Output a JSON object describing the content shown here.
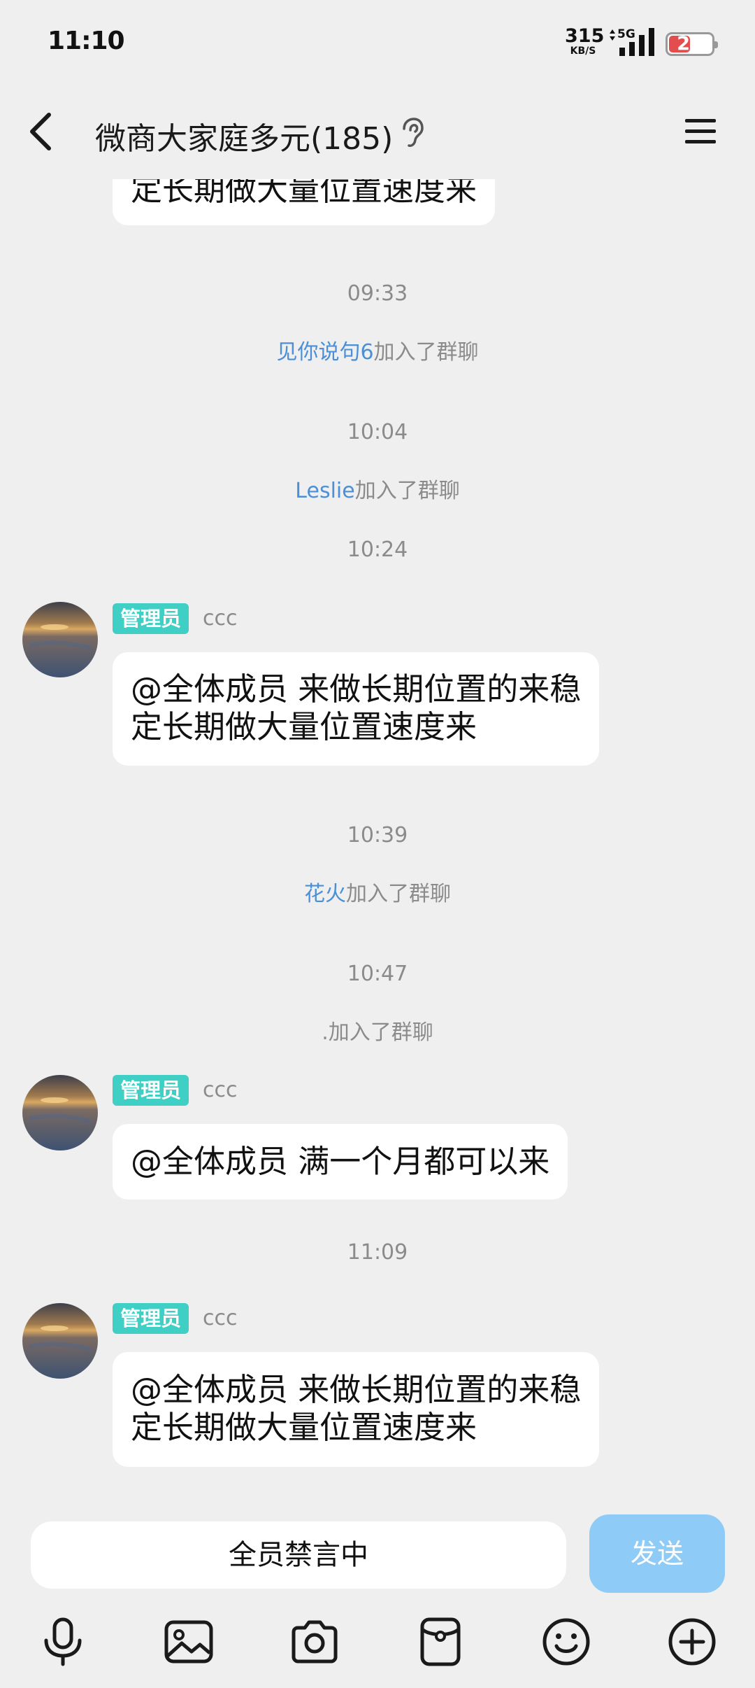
{
  "status_bar": {
    "time": "11:10",
    "net_speed": "315",
    "net_unit": "KB/S",
    "network": "5G",
    "battery": "20"
  },
  "header": {
    "title": "微商大家庭多元(185)",
    "back_icon": "chevron-left-icon",
    "ear_icon": "ear-icon",
    "menu_icon": "hamburger-menu-icon"
  },
  "messages": {
    "partial_top": {
      "text": "定长期做大量位置速度来"
    },
    "t1": "09:33",
    "join1": {
      "name": "见你说句6",
      "suffix": "加入了群聊"
    },
    "t2": "10:04",
    "join2": {
      "name": "Leslie",
      "suffix": "加入了群聊"
    },
    "t3": "10:24",
    "msg1": {
      "badge": "管理员",
      "sender": "ccc",
      "line1": "@全体成员 来做长期位置的来稳",
      "line2": "定长期做大量位置速度来"
    },
    "t4": "10:39",
    "join3": {
      "name": "花火",
      "suffix": "加入了群聊"
    },
    "t5": "10:47",
    "join4": {
      "name": ".",
      "suffix": "加入了群聊"
    },
    "msg2": {
      "badge": "管理员",
      "sender": "ccc",
      "line1": "@全体成员 满一个月都可以来"
    },
    "t6": "11:09",
    "msg3": {
      "badge": "管理员",
      "sender": "ccc",
      "line1": "@全体成员 来做长期位置的来稳",
      "line2": "定长期做大量位置速度来"
    }
  },
  "input": {
    "muted_text": "全员禁言中",
    "send_label": "发送"
  },
  "toolbar": [
    "microphone-icon",
    "image-icon",
    "camera-icon",
    "red-packet-icon",
    "emoji-icon",
    "plus-icon"
  ],
  "colors": {
    "background": "#efefef",
    "badge": "#3fcfc4",
    "link_name": "#4a8fd8",
    "send_button": "#8ecbf6",
    "battery_low": "#e44d4d"
  }
}
